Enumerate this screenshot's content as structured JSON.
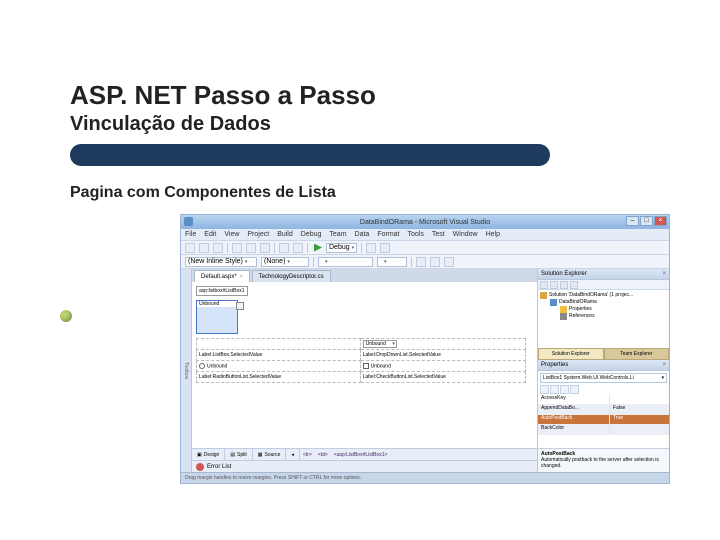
{
  "slide": {
    "title": "ASP. NET Passo a Passo",
    "subtitle": "Vinculação de Dados",
    "caption": "Pagina com Componentes de Lista"
  },
  "ide": {
    "window_title": "DataBindORama - Microsoft Visual Studio",
    "menus": [
      "File",
      "Edit",
      "View",
      "Project",
      "Build",
      "Debug",
      "Team",
      "Data",
      "Format",
      "Tools",
      "Test",
      "Window",
      "Help"
    ],
    "toolbar1": {
      "style_text": "(New Inline Style)",
      "rule": "(None)",
      "config": "Debug"
    },
    "tabs": [
      {
        "label": "Default.aspx*",
        "active": true
      },
      {
        "label": "TechnologyDescriptor.cs",
        "active": false
      }
    ],
    "designer": {
      "asp_tag": "asp:listbox#ListBox1",
      "unbound": "Unbound",
      "cells": {
        "r1c1": "",
        "r1c2": "Unbound",
        "r2c1": "Label:ListBox.SelectedValue",
        "r2c2": "Label:DropDownList.SelectedValue",
        "r3c1": "Unbound",
        "r3c2": "Unbound",
        "r4c1": "Label:RadioButtonList.SelectedValue",
        "r4c2": "Label:CheckButtonList.SelectedValue"
      }
    },
    "viewswitch": {
      "design": "Design",
      "split": "Split",
      "source": "Source",
      "path": [
        "<tr>",
        "<td>",
        "<asp:ListBox#ListBox1>"
      ]
    },
    "errorlist": "Error List",
    "statusbar": "Drag margin handles to resize margins. Press SHIFT or CTRL for more options.",
    "solution": {
      "title": "Solution Explorer",
      "nodes": [
        "Solution 'DataBindORama' (1 projec...",
        "DataBindORama",
        "Properties",
        "References"
      ],
      "tabs": [
        "Solution Explorer",
        "Team Explorer"
      ]
    },
    "properties": {
      "title": "Properties",
      "selector": "ListBox1  System.Web.UI.WebControls.Li",
      "rows": [
        {
          "k": "AccessKey",
          "v": "",
          "hl": false,
          "sel": false
        },
        {
          "k": "AppendDataBo...",
          "v": "False",
          "hl": true,
          "sel": false
        },
        {
          "k": "AutoPostBack",
          "v": "True",
          "hl": false,
          "sel": true
        },
        {
          "k": "BackColor",
          "v": "",
          "hl": true,
          "sel": false
        }
      ],
      "desc_name": "AutoPostBack",
      "desc_text": "Automatically postback to the server after selection is changed."
    }
  }
}
